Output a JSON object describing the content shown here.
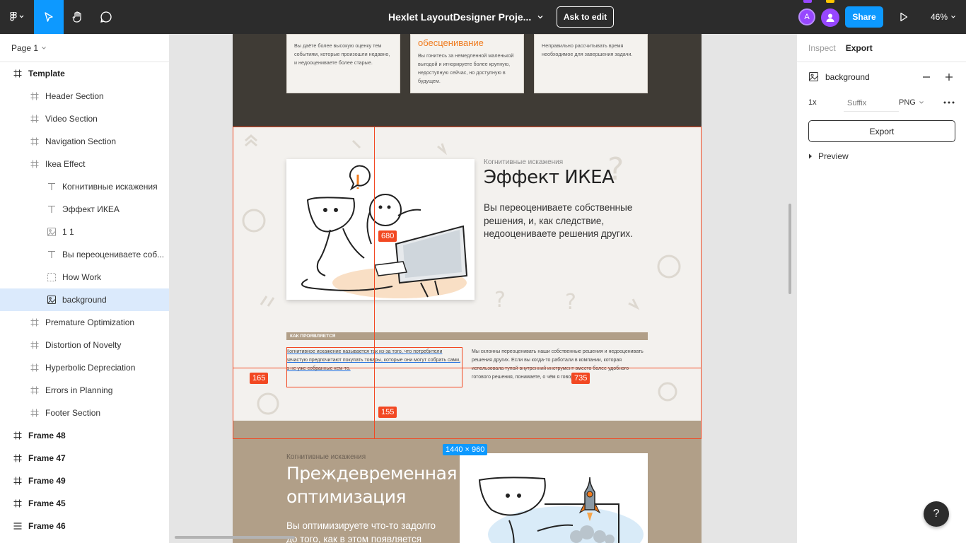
{
  "toolbar": {
    "doc_title": "Hexlet LayoutDesigner Proje...",
    "ask_to_edit": "Ask to edit",
    "avatar_initial": "A",
    "share": "Share",
    "zoom": "46%"
  },
  "sidebar": {
    "page": "Page 1",
    "layers": [
      {
        "label": "Template",
        "icon": "frame-icon"
      },
      {
        "label": "Header Section",
        "icon": "frame-icon"
      },
      {
        "label": "Video Section",
        "icon": "frame-icon"
      },
      {
        "label": "Navigation Section",
        "icon": "frame-icon"
      },
      {
        "label": "Ikea Effect",
        "icon": "frame-icon"
      },
      {
        "label": "Когнитивные искажения",
        "icon": "text-icon"
      },
      {
        "label": "Эффект ИКЕА",
        "icon": "text-icon"
      },
      {
        "label": "1 1",
        "icon": "image-icon"
      },
      {
        "label": "Вы переоцениваете соб...",
        "icon": "text-icon"
      },
      {
        "label": "How Work",
        "icon": "dashed-frame-icon"
      },
      {
        "label": "background",
        "icon": "image-icon"
      },
      {
        "label": "Premature Optimization",
        "icon": "frame-icon"
      },
      {
        "label": "Distortion of Novelty",
        "icon": "frame-icon"
      },
      {
        "label": "Hyperbolic Depreciation",
        "icon": "frame-icon"
      },
      {
        "label": "Errors in Planning",
        "icon": "frame-icon"
      },
      {
        "label": "Footer Section",
        "icon": "frame-icon"
      },
      {
        "label": "Frame 48",
        "icon": "frame-icon"
      },
      {
        "label": "Frame 47",
        "icon": "frame-icon"
      },
      {
        "label": "Frame 49",
        "icon": "frame-icon"
      },
      {
        "label": "Frame 45",
        "icon": "frame-icon"
      },
      {
        "label": "Frame 46",
        "icon": "rows-icon"
      }
    ]
  },
  "canvas": {
    "cards": [
      {
        "title": "",
        "text": "Вы даёте более высокую оценку тем событиям, которые произошли недавно, и недооцениваете более старые."
      },
      {
        "title": "обесценивание",
        "text": "Вы гонитесь за немедленной маленькой выгодой и игнорируете более крупную, недоступную сейчас, но доступную в будущем."
      },
      {
        "title": "",
        "text": "Неправильно рассчитывать время необходимое для завершения задачи."
      }
    ],
    "ikea": {
      "subtitle": "Когнитивные искажения",
      "title": "Эффект ИКЕА",
      "description": "Вы переоцениваете собственные решения, и, как следствие, недооцениваете решения других.",
      "how_label": "КАК ПРОЯВЛЯЕТСЯ",
      "how_left": "Когнитивное искажение называется так из-за того, что потребители зачастую предпочитают покупать товары, которые они могут собрать сами, а не уже собранные кем-то.",
      "how_right": "Мы склонны переоценивать наши собственные решения и недооценивать решения других. Если вы когда-то работали в компании, которая использовала тупой внутренний инструмент вместо более удобного готового решения, понимаете, о чём я говорю."
    },
    "premature": {
      "subtitle": "Когнитивные искажения",
      "title": "Преждевременная оптимизация",
      "description": "Вы оптимизируете что-то задолго до того, как в этом появляется"
    },
    "measurements": {
      "m680": "680",
      "m165": "165",
      "m735": "735",
      "m155": "155",
      "size": "1440 × 960"
    }
  },
  "right_panel": {
    "tabs": [
      "Inspect",
      "Export"
    ],
    "active_tab": "Export",
    "layer_name": "background",
    "scale": "1x",
    "suffix_placeholder": "Suffix",
    "format": "PNG",
    "export_button": "Export",
    "preview": "Preview"
  },
  "colors": {
    "accent": "#0d99ff",
    "measure": "#f24822",
    "toolbar_bg": "#2c2c2c"
  }
}
